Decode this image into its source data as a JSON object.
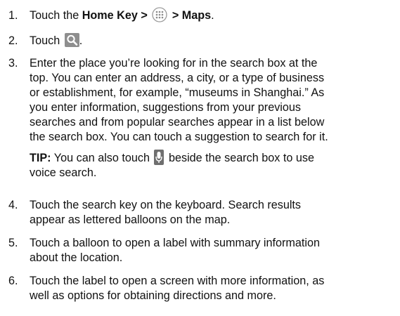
{
  "steps": [
    {
      "number": "1.",
      "text_touch": "Touch the ",
      "home_key": "Home Key >",
      "sep": " > ",
      "maps": "Maps",
      "end": "."
    },
    {
      "number": "2.",
      "text_touch": "Touch ",
      "end": "."
    },
    {
      "number": "3.",
      "lines": [
        "Enter the place you’re looking for in the search box at the",
        "top. You can enter an address, a city, or a type of business",
        "or establishment, for example, “museums in Shanghai.” As",
        "you enter information, suggestions from your previous",
        "searches and from popular searches appear in a list below",
        "the search box. You can touch a suggestion to search for it."
      ],
      "tip_label": "TIP:",
      "tip_before": " You can also touch ",
      "tip_after_line1": " beside the search box to use",
      "tip_line2": "voice search."
    },
    {
      "number": "4.",
      "lines": [
        "Touch the search key on the keyboard. Search results",
        "appear as lettered balloons on the map."
      ]
    },
    {
      "number": "5.",
      "lines": [
        "Touch a balloon to open a label with summary information",
        "about the location."
      ]
    },
    {
      "number": "6.",
      "lines": [
        "Touch the label to open a screen with more information, as",
        "well as options for obtaining directions and more."
      ]
    }
  ],
  "icons": {
    "apps": "apps-grid-icon",
    "search": "search-icon",
    "mic": "microphone-icon"
  }
}
